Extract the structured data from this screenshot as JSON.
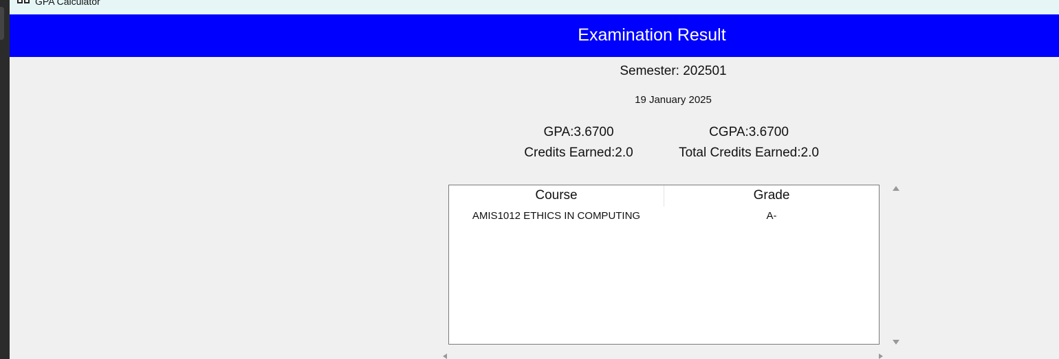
{
  "window": {
    "title": "GPA Calculator",
    "icon": "gpa-calculator-app-icon"
  },
  "header": {
    "title": "Examination Result",
    "background_color": "#0000fe",
    "text_color": "#ffffff"
  },
  "summary": {
    "semester": "Semester: 202501",
    "date": "19 January 2025",
    "gpa": "GPA:3.6700",
    "cgpa": "CGPA:3.6700",
    "credits_earned": "Credits Earned:2.0",
    "total_credits_earned": "Total Credits Earned:2.0"
  },
  "results_table": {
    "columns": [
      "Course",
      "Grade"
    ],
    "rows": [
      {
        "course": "AMIS1012 ETHICS IN COMPUTING",
        "grade": "A-"
      }
    ]
  },
  "scrollbars": {
    "vertical_icons": [
      "scroll-up-arrow-icon",
      "scroll-down-arrow-icon"
    ],
    "horizontal_icons": [
      "scroll-left-arrow-icon",
      "scroll-right-arrow-icon"
    ]
  }
}
